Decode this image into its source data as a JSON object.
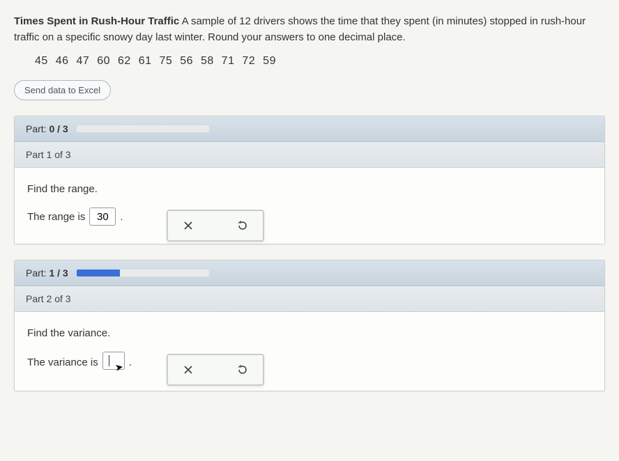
{
  "problem": {
    "title": "Times Spent in Rush-Hour Traffic",
    "description": "A sample of 12 drivers shows the time that they spent (in minutes) stopped in rush-hour traffic on a specific snowy day last winter. Round your answers to one decimal place.",
    "data_values": "45  46  47  60  62  61  75  56  58  71  72  59"
  },
  "buttons": {
    "send_excel": "Send data to Excel"
  },
  "section1": {
    "progress_label_prefix": "Part: ",
    "progress_value": "0 / 3",
    "subheader": "Part 1 of 3",
    "prompt": "Find the range.",
    "answer_prefix": "The range is",
    "answer_value": "30",
    "answer_suffix": "."
  },
  "section2": {
    "progress_label_prefix": "Part: ",
    "progress_value": "1 / 3",
    "subheader": "Part 2 of 3",
    "prompt": "Find the variance.",
    "answer_prefix": "The variance is",
    "answer_value": "",
    "answer_suffix": "."
  },
  "icons": {
    "close": "close-icon",
    "reset": "reset-icon"
  }
}
